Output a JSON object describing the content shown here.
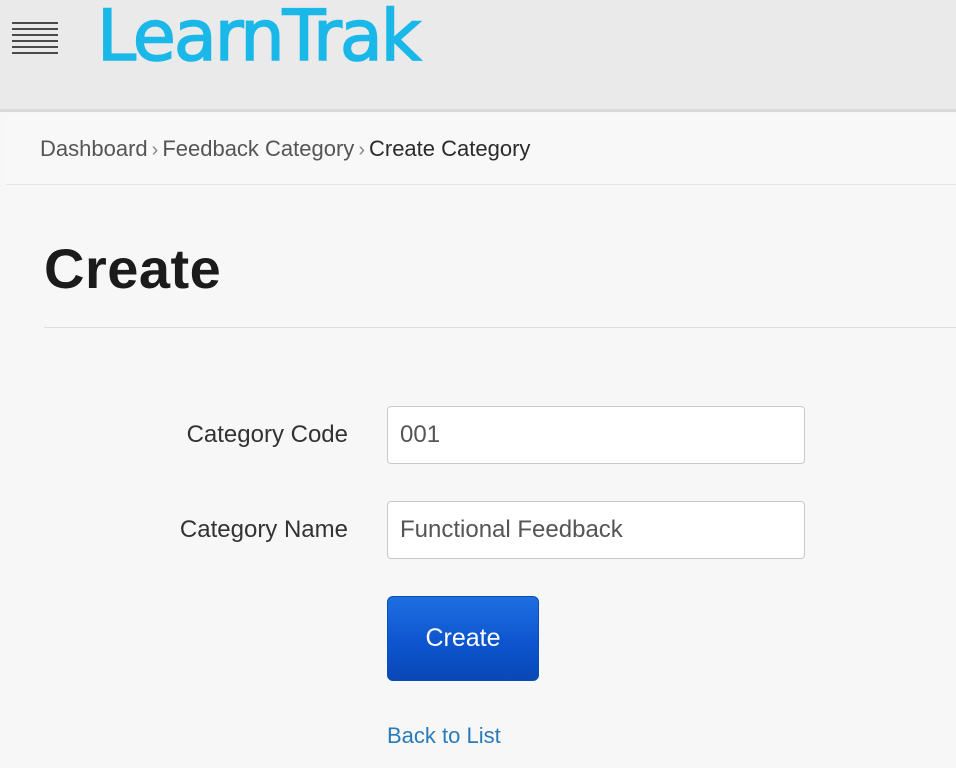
{
  "header": {
    "logo_text": "LearnTrak",
    "menu_icon": "hamburger-menu-icon",
    "brand_color": "#1ab8e8"
  },
  "breadcrumb": {
    "items": [
      "Dashboard",
      "Feedback Category"
    ],
    "current": "Create Category",
    "separator_icon": "chevron-right-icon"
  },
  "page": {
    "title": "Create"
  },
  "form": {
    "category_code": {
      "label": "Category Code",
      "value": "001"
    },
    "category_name": {
      "label": "Category Name",
      "value": "Functional Feedback"
    },
    "submit_label": "Create",
    "back_link_label": "Back to List"
  }
}
